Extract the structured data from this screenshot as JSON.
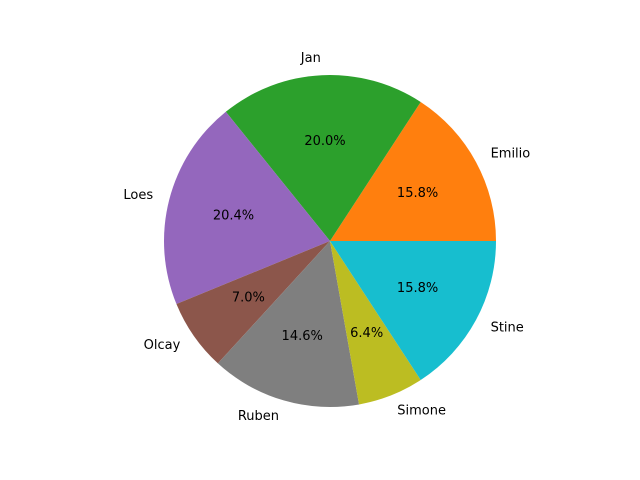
{
  "chart_data": {
    "type": "pie",
    "title": "",
    "labels": [
      "Emilio",
      "Jan",
      "Loes",
      "Olcay",
      "Ruben",
      "Simone",
      "Stine"
    ],
    "values": [
      15.8,
      20.0,
      20.4,
      7.0,
      14.6,
      6.4,
      15.8
    ],
    "value_labels": [
      "15.8%",
      "20.0%",
      "20.4%",
      "7.0%",
      "14.6%",
      "6.4%",
      "15.8%"
    ],
    "colors": [
      "#ff7f0e",
      "#2ca02c",
      "#9467bd",
      "#8c564b",
      "#7f7f7f",
      "#bcbd22",
      "#17becf"
    ],
    "start_angle_deg": 0,
    "direction": "counterclockwise",
    "legend": "none"
  }
}
